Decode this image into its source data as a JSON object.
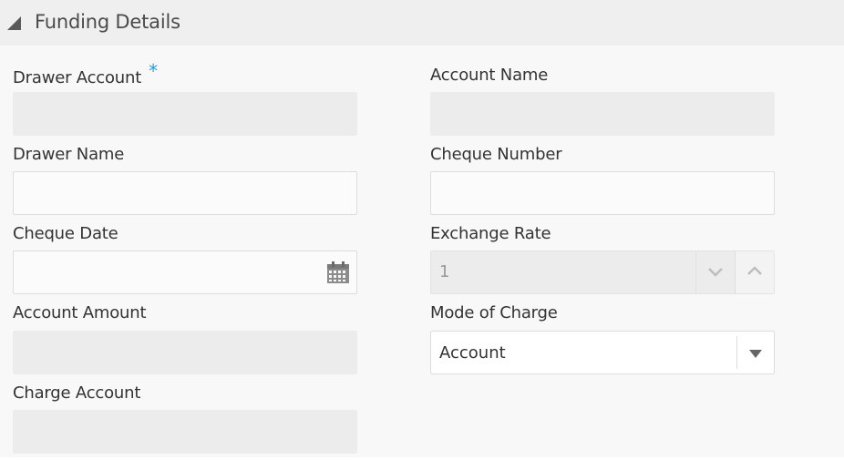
{
  "panel": {
    "title": "Funding Details",
    "collapse_icon": "triangle-collapse-icon"
  },
  "fields": {
    "drawer_account": {
      "label": "Drawer Account",
      "required_marker": "*",
      "value": ""
    },
    "account_name": {
      "label": "Account Name",
      "value": ""
    },
    "drawer_name": {
      "label": "Drawer Name",
      "value": ""
    },
    "cheque_number": {
      "label": "Cheque Number",
      "value": ""
    },
    "cheque_date": {
      "label": "Cheque Date",
      "value": "",
      "icon": "calendar-icon"
    },
    "exchange_rate": {
      "label": "Exchange Rate",
      "value": "1"
    },
    "account_amount": {
      "label": "Account Amount",
      "value": ""
    },
    "mode_of_charge": {
      "label": "Mode of Charge",
      "value": "Account"
    },
    "charge_account": {
      "label": "Charge Account",
      "value": ""
    }
  },
  "colors": {
    "required_accent": "#2a9bd7",
    "disabled_field": "#ececec",
    "panel_header": "#efefef"
  }
}
